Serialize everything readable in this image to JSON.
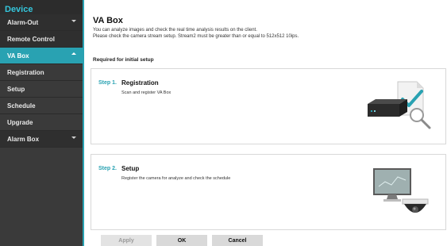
{
  "sidebar": {
    "header": "Device",
    "items": [
      {
        "label": "Alarm-Out"
      },
      {
        "label": "Remote Control"
      },
      {
        "label": "VA Box"
      },
      {
        "label": "Registration"
      },
      {
        "label": "Setup"
      },
      {
        "label": "Schedule"
      },
      {
        "label": "Upgrade"
      },
      {
        "label": "Alarm Box"
      }
    ]
  },
  "main": {
    "title": "VA Box",
    "desc1": "You can analyze images and check the real time analysis results on the client.",
    "desc2": "Please check the camera stream setup. Stream2 must be greater than or equal to 512x512 10ips.",
    "required_label": "Required for initial setup",
    "steps": [
      {
        "step": "Step 1.",
        "title": "Registration",
        "desc": "Scan and register VA Box",
        "icon": "va-box-register-icon"
      },
      {
        "step": "Step 2.",
        "title": "Setup",
        "desc": "Register the camera for analyze and check the schedule",
        "icon": "camera-setup-icon"
      }
    ]
  },
  "buttons": {
    "apply": "Apply",
    "ok": "OK",
    "cancel": "Cancel"
  },
  "colors": {
    "accent": "#29a2b2",
    "sidebar": "#3a3a3a",
    "header_text": "#35c6dc"
  }
}
